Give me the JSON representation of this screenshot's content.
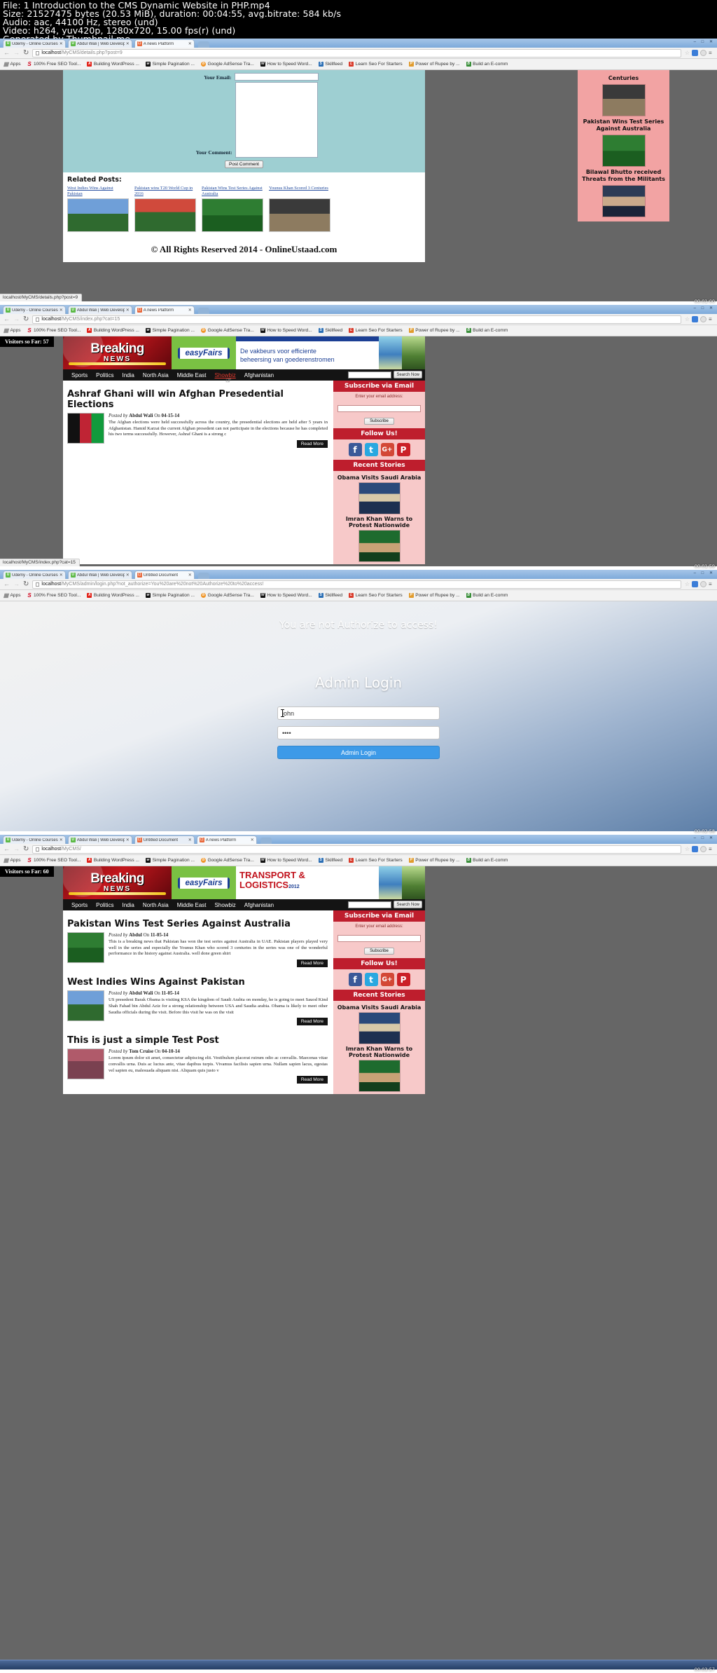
{
  "meta": {
    "line1": "File: 1 Introduction to the CMS Dynamic Website in PHP.mp4",
    "line2": "Size: 21527475 bytes (20.53 MiB), duration: 00:04:55, avg.bitrate: 584 kb/s",
    "line3": "Audio: aac, 44100 Hz, stereo (und)",
    "line4": "Video: h264, yuv420p, 1280x720, 15.00 fps(r) (und)",
    "line5": "Generated by Thumbnail me"
  },
  "bookmarks": [
    {
      "label": "Apps",
      "icon": "apps-grid-icon"
    },
    {
      "label": "100% Free SEO Tool...",
      "icon": "seo-icon"
    },
    {
      "label": "Building WordPress ...",
      "icon": "wordpress-icon"
    },
    {
      "label": "Simple Pagination ...",
      "icon": "pagination-icon"
    },
    {
      "label": "Google AdSense Tra...",
      "icon": "adsense-icon"
    },
    {
      "label": "How to Speed Word...",
      "icon": "speed-icon"
    },
    {
      "label": "Skillfeed",
      "icon": "skillfeed-icon"
    },
    {
      "label": "Learn Seo For Starters",
      "icon": "learnseo-icon"
    },
    {
      "label": "Power of Rupee by ...",
      "icon": "rupee-icon"
    },
    {
      "label": "Build an E-comm",
      "icon": "ecommerce-icon"
    }
  ],
  "panels": [
    {
      "id": "panel-details",
      "timestamp": "00:01:00",
      "tabs": [
        {
          "label": "Udemy - Online Courses",
          "icon": "udemy-icon",
          "active": false
        },
        {
          "label": "Abdul Wali | Web Develop",
          "icon": "udemy-icon",
          "active": false
        },
        {
          "label": "A news Platform",
          "icon": "document-icon",
          "active": true
        }
      ],
      "url_host": "localhost",
      "url_path": "/MyCMS/details.php?post=9",
      "status": "localhost/MyCMS/details.php?post=9",
      "comment_form": {
        "email_label": "Your Email:",
        "comment_label": "Your Comment:",
        "post_button": "Post Comment"
      },
      "related": {
        "heading": "Related Posts:",
        "items": [
          {
            "title": "West Indies Wins Against Pakistan",
            "thumb": "ph-cric1"
          },
          {
            "title": "Pakistan wins T20 World Cup in 2016",
            "thumb": "ph-cric2"
          },
          {
            "title": "Pakistan Wins Test Series Against Australia",
            "thumb": "ph-cric3"
          },
          {
            "title": "Younus Khan Scored 3 Centuries",
            "thumb": "ph-cric4"
          }
        ]
      },
      "right_sidebar": [
        {
          "title": "Centuries",
          "thumb": "ph-cric4",
          "order": "title-first"
        },
        {
          "title": "Pakistan Wins Test Series Against Australia",
          "thumb": "ph-cric3",
          "order": "title-first"
        },
        {
          "title": "Bilawal Bhutto received Threats from the Militants",
          "thumb": "ph-bilawal",
          "order": "title-first"
        }
      ],
      "footer": "© All Rights Reserved 2014 - OnlineUstaad.com"
    },
    {
      "id": "panel-category",
      "timestamp": "00:01:59",
      "tabs": [
        {
          "label": "Udemy - Online Courses",
          "icon": "udemy-icon",
          "active": false
        },
        {
          "label": "Abdul Wali | Web Develop",
          "icon": "udemy-icon",
          "active": false
        },
        {
          "label": "A news Platform",
          "icon": "document-icon",
          "active": true
        }
      ],
      "url_host": "localhost",
      "url_path": "/MyCMS/index.php?cat=15",
      "status": "localhost/MyCMS/index.php?cat=15",
      "visitors": "Visitors so Far: 57",
      "banner": {
        "breaking_line1": "Breaking",
        "breaking_line2": "NEWS",
        "sponsor": "easyFairs",
        "sponsor_text_line1": "De vakbeurs voor efficiente",
        "sponsor_text_line2": "beheersing van goederenstromen"
      },
      "nav": [
        "Sports",
        "Politics",
        "India",
        "North Asia",
        "Middle East",
        "Showbiz",
        "Afghanistan"
      ],
      "nav_active": "Showbiz",
      "search_placeholder": "",
      "search_button": "Search Now",
      "posts": [
        {
          "title": "Ashraf Ghani will win Afghan Presedential Elections",
          "posted_by_label": "Posted by",
          "author": "Abdul Wali",
          "on_label": "On",
          "date": "04-15-14",
          "excerpt": "The Afghan elections were held successfully across the country, the presedential elections are held after 5 years in Afghanistan. Hamid Karzai the current Afghan presedent can not participate in the elections because he has completed his two terms successfully. However, Ashraf Ghani is a strong c",
          "read_more": "Read More",
          "thumb": "ph-flagaf"
        }
      ],
      "sidebar": {
        "subscribe_head": "Subscribe via Email",
        "subscribe_label": "Enter your email address:",
        "subscribe_button": "Subscribe",
        "follow_head": "Follow Us!",
        "socials": [
          "facebook-icon",
          "twitter-icon",
          "googleplus-icon",
          "pinterest-icon"
        ],
        "recent_head": "Recent Stories",
        "recent": [
          {
            "title": "Obama Visits Saudi Arabia",
            "thumb": "ph-obama"
          },
          {
            "title": "Imran Khan Warns to Protest Nationwide",
            "thumb": "ph-imran"
          }
        ]
      }
    },
    {
      "id": "panel-admin-login",
      "timestamp": "00:02:58",
      "tabs": [
        {
          "label": "Udemy - Online Courses",
          "icon": "udemy-icon",
          "active": false
        },
        {
          "label": "Abdul Wali | Web Develop",
          "icon": "udemy-icon",
          "active": false
        },
        {
          "label": "Untitled Document",
          "icon": "document-icon",
          "active": true
        }
      ],
      "url_host": "localhost",
      "url_path": "/MyCMS/admin/login.php?not_authorize=You%20are%20not%20Authorize%20to%20access!",
      "not_authorized": "You are not Authorize to access!",
      "title": "Admin Login",
      "username_value": "john",
      "password_value": "••••",
      "login_button": "Admin Login"
    },
    {
      "id": "panel-home",
      "timestamp": "00:03:57",
      "tabs": [
        {
          "label": "Udemy - Online Courses",
          "icon": "udemy-icon",
          "active": false
        },
        {
          "label": "Abdul Wali | Web Develop",
          "icon": "udemy-icon",
          "active": false
        },
        {
          "label": "Untitled Document",
          "icon": "document-icon",
          "active": false
        },
        {
          "label": "A news Platform",
          "icon": "document-icon",
          "active": true
        }
      ],
      "url_host": "localhost",
      "url_path": "/MyCMS/",
      "visitors": "Visitors so Far: 60",
      "banner": {
        "breaking_line1": "Breaking",
        "breaking_line2": "NEWS",
        "sponsor": "easyFairs",
        "sponsor_text_line1": "TRANSPORT &",
        "sponsor_text_line2": "LOGISTICS",
        "sponsor_text_year": "2012"
      },
      "nav": [
        "Sports",
        "Politics",
        "India",
        "North Asia",
        "Middle East",
        "Showbiz",
        "Afghanistan"
      ],
      "nav_active": "",
      "search_button": "Search Now",
      "posts": [
        {
          "title": "Pakistan Wins Test Series Against Australia",
          "posted_by_label": "Posted by",
          "author": "Abdul",
          "on_label": "On",
          "date": "11-05-14",
          "excerpt": "This is a breaking news that Pakistan has won the test series against Australia in UAE. Pakistan players played very well in the series and especially the Younus Khan who scored 3 centuries in the series was one of the wonderful performance in the history against Australia. well done green shirt",
          "read_more": "Read More",
          "thumb": "ph-cric3"
        },
        {
          "title": "West Indies Wins Against Pakistan",
          "posted_by_label": "Posted by",
          "author": "Abdul Wali",
          "on_label": "On",
          "date": "11-05-14",
          "excerpt": "US presedent Barak Obama is visiting KSA the kingdom of Saudi Arabia on monday, he is going to meet Sauod Kind Shah Fahad bin Abdul Aziz for a strong relationship between USA and Saudia arabia. Obama is likely to meet other Saudia officials during the visit. Before this visit he was on the visit",
          "read_more": "Read More",
          "thumb": "ph-cric1"
        },
        {
          "title": "This is just a simple Test Post",
          "posted_by_label": "Posted by",
          "author": "Tom Cruise",
          "on_label": "On",
          "date": "04-10-14",
          "excerpt": "Lorem ipsum dolor sit amet, consectetur adipiscing elit. Vestibulum placerat rutrum odio ac convallis. Maecenas vitae convallis urna. Duis ac luctus ante, vitae dapibus turpis. Vivamus facilisis sapien urna. Nullam sapien lacus, egestas vel sapien eu, malesuada aliquam nisi. Aliquam quis justo v",
          "read_more": "Read More",
          "thumb": "ph-girl"
        }
      ],
      "sidebar": {
        "subscribe_head": "Subscribe via Email",
        "subscribe_label": "Enter your email address:",
        "subscribe_button": "Subscribe",
        "follow_head": "Follow Us!",
        "socials": [
          "facebook-icon",
          "twitter-icon",
          "googleplus-icon",
          "pinterest-icon"
        ],
        "recent_head": "Recent Stories",
        "recent": [
          {
            "title": "Obama Visits Saudi Arabia",
            "thumb": "ph-obama"
          },
          {
            "title": "Imran Khan Warns to Protest Nationwide",
            "thumb": "ph-imran"
          }
        ]
      }
    }
  ]
}
